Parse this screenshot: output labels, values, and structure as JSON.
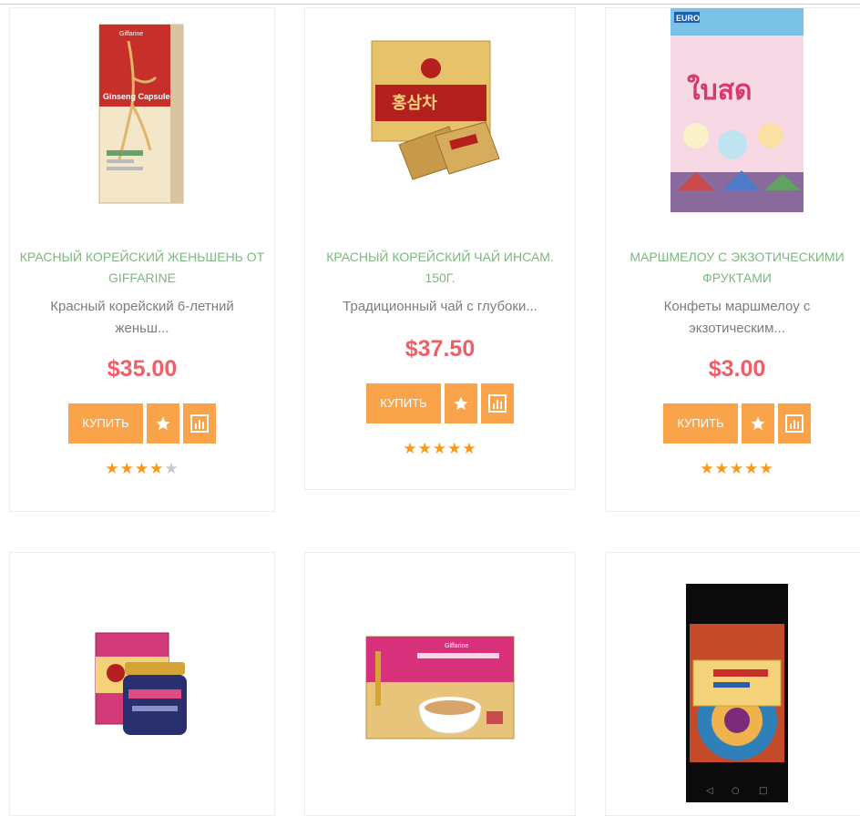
{
  "products": [
    {
      "title": "Красный корейский женьшень от GIFFARINE",
      "desc": "Красный корейский 6-летний женьш...",
      "price": "$35.00",
      "buy": "КУПИТЬ",
      "rating": 4,
      "image": "ginseng-capsule-box"
    },
    {
      "title": "Красный корейский чай Инсам. 150г.",
      "desc": "Традиционный чай с глубоки...",
      "price": "$37.50",
      "buy": "КУПИТЬ",
      "rating": 5,
      "image": "red-ginseng-tea-box"
    },
    {
      "title": "Маршмелоу с экзотическими фруктами",
      "desc": "Конфеты маршмелоу с экзотическим...",
      "price": "$3.00",
      "buy": "КУПИТЬ",
      "rating": 5,
      "image": "marshmallow-bag"
    },
    {
      "image": "ginseng-extract-jar"
    },
    {
      "image": "ginseng-coffee-box"
    },
    {
      "image": "ginseng-phone-photo"
    }
  ],
  "image_text": {
    "p1": "Ginseng Capsule",
    "p1_brand": "Giffarine",
    "p2": "홍삼차",
    "p3": "EURO",
    "p3_brand": "ใบสด",
    "p5": "Giffarine"
  },
  "colors": {
    "title": "#7fb77e",
    "price": "#ee5f67",
    "button": "#f9a44a",
    "star": "#f79a1c"
  }
}
